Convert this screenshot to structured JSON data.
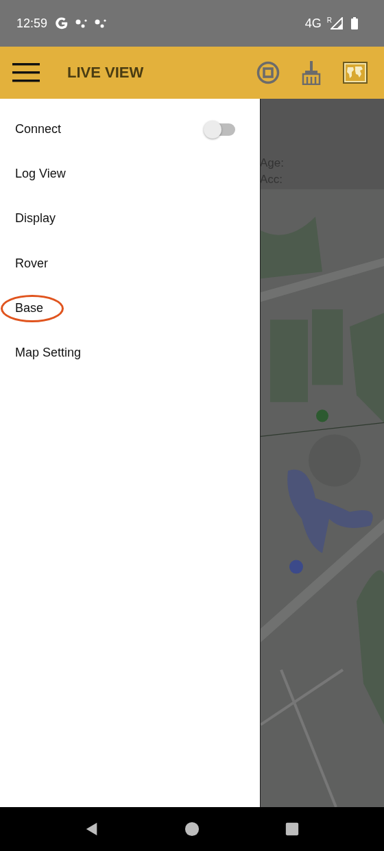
{
  "status_bar": {
    "time": "12:59",
    "network": "4G",
    "roaming": "R"
  },
  "app_bar": {
    "title": "LIVE VIEW"
  },
  "drawer": {
    "items": [
      {
        "label": "Connect",
        "kind": "toggle",
        "on": false,
        "highlighted": false
      },
      {
        "label": "Log View",
        "kind": "link",
        "highlighted": false
      },
      {
        "label": "Display",
        "kind": "link",
        "highlighted": false
      },
      {
        "label": "Rover",
        "kind": "link",
        "highlighted": false
      },
      {
        "label": "Base",
        "kind": "link",
        "highlighted": true
      },
      {
        "label": "Map Setting",
        "kind": "link",
        "highlighted": false
      }
    ]
  },
  "info_panel": {
    "lines": [
      "Age:",
      "Acc:"
    ]
  }
}
